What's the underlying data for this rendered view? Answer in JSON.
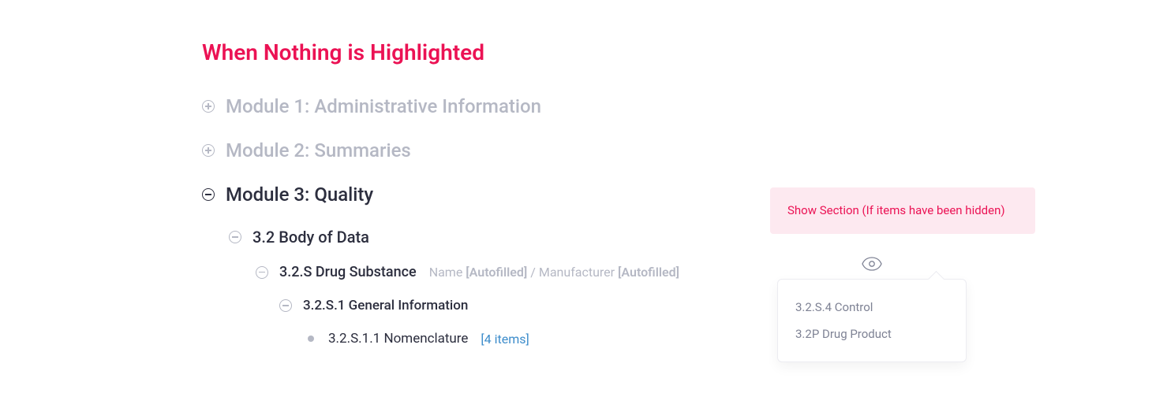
{
  "title": "When Nothing is Highlighted",
  "modules": {
    "m1": "Module 1: Administrative Information",
    "m2": "Module 2: Summaries",
    "m3": "Module 3: Quality"
  },
  "tree": {
    "s32": "3.2 Body of Data",
    "s32S": "3.2.S Drug Substance",
    "s32S_meta_name_label": "Name ",
    "s32S_meta_name_value": "[Autofilled]",
    "s32S_meta_sep": " / ",
    "s32S_meta_manu_label": "Manufacturer ",
    "s32S_meta_manu_value": "[Autofilled]",
    "s32S1": "3.2.S.1 General Information",
    "s32S11": "3.2.S.1.1 Nomenclature",
    "s32S11_count": "[4 items]"
  },
  "sidebox": "Show Section (If items have been hidden)",
  "popover": {
    "item1": "3.2.S.4 Control",
    "item2": "3.2P Drug Product"
  }
}
